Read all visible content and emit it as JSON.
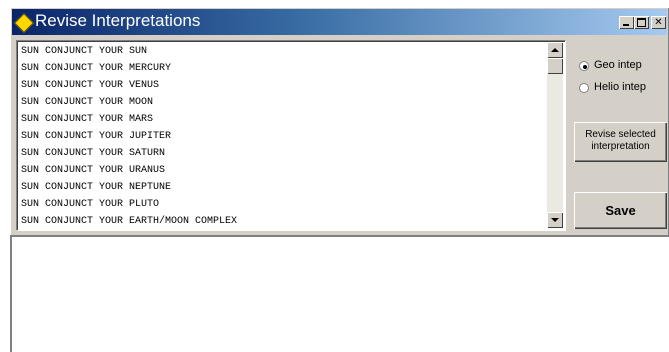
{
  "window": {
    "title": "Revise Interpretations"
  },
  "interpretations": {
    "items": [
      "SUN CONJUNCT YOUR SUN",
      "SUN CONJUNCT YOUR MERCURY",
      "SUN CONJUNCT YOUR VENUS",
      "SUN CONJUNCT YOUR MOON",
      "SUN CONJUNCT YOUR MARS",
      "SUN CONJUNCT YOUR JUPITER",
      "SUN CONJUNCT YOUR SATURN",
      "SUN CONJUNCT YOUR URANUS",
      "SUN CONJUNCT YOUR NEPTUNE",
      "SUN CONJUNCT YOUR PLUTO",
      "SUN CONJUNCT YOUR EARTH/MOON COMPLEX"
    ]
  },
  "options": {
    "geo_label": "Geo intep",
    "helio_label": "Helio intep",
    "selected": "geo"
  },
  "buttons": {
    "revise_line1": "Revise selected",
    "revise_line2": "interpretation",
    "save": "Save"
  },
  "editor": {
    "value": ""
  },
  "colors": {
    "titlebar_start": "#0a246a",
    "titlebar_end": "#a6caf0",
    "face": "#d4d0c8",
    "icon": "#ffd800"
  }
}
